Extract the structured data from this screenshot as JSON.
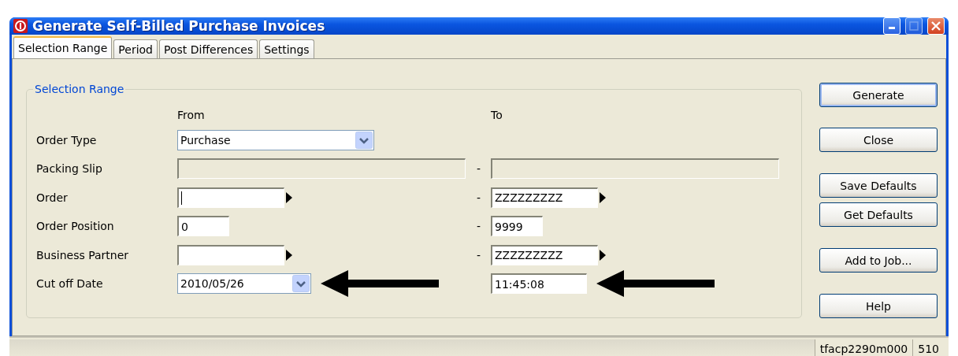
{
  "window": {
    "title": "Generate Self-Billed Purchase Invoices"
  },
  "tabs": [
    {
      "label": "Selection Range",
      "selected": true
    },
    {
      "label": "Period",
      "selected": false
    },
    {
      "label": "Post Differences",
      "selected": false
    },
    {
      "label": "Settings",
      "selected": false
    }
  ],
  "group": {
    "title": "Selection Range",
    "from_header": "From",
    "to_header": "To",
    "rows": [
      {
        "label": "Order Type",
        "from": {
          "kind": "combo",
          "value": "Purchase"
        }
      },
      {
        "label": "Packing Slip",
        "from": {
          "kind": "wide",
          "disabled": true
        },
        "dash": "-",
        "to": {
          "kind": "wide",
          "disabled": true
        }
      },
      {
        "label": "Order",
        "from": {
          "kind": "zoom",
          "focused": true
        },
        "dash": "-",
        "to": {
          "kind": "zoom",
          "value": "ZZZZZZZZZ"
        }
      },
      {
        "label": "Order Position",
        "from": {
          "kind": "short",
          "value": "0"
        },
        "dash": "-",
        "to": {
          "kind": "short",
          "value": "9999"
        }
      },
      {
        "label": "Business Partner",
        "from": {
          "kind": "zoom"
        },
        "dash": "-",
        "to": {
          "kind": "zoom",
          "value": "ZZZZZZZZZ"
        }
      },
      {
        "label": "Cut off Date",
        "from": {
          "kind": "date",
          "value": "2010/05/26",
          "marked": true
        },
        "to": {
          "kind": "time",
          "value": "11:45:08",
          "marked": true
        }
      }
    ]
  },
  "buttons": [
    "Generate",
    "Close",
    "Save Defaults",
    "Get Defaults",
    "Add to Job...",
    "Help"
  ],
  "status_bar": {
    "program": "tfacp2290m000",
    "session": "510"
  }
}
